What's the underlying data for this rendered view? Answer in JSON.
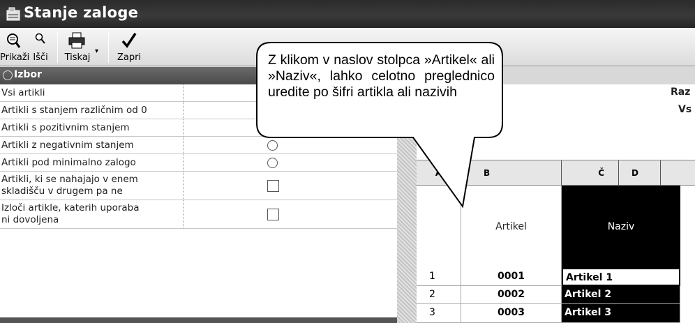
{
  "window": {
    "title": "Stanje zaloge"
  },
  "toolbar": {
    "buttons": [
      {
        "label": "Prikaži",
        "icon": "view-icon"
      },
      {
        "label": "Išči",
        "icon": "search-icon"
      },
      {
        "label": "Tiskaj",
        "icon": "printer-icon"
      },
      {
        "label": "Zapri",
        "icon": "checkmark-icon"
      }
    ]
  },
  "panel": {
    "title": "Izbor",
    "options": [
      {
        "label": "Vsi artikli",
        "control": "radio",
        "selected": false
      },
      {
        "label": "Artikli s stanjem različnim od 0",
        "control": "radio",
        "selected": true
      },
      {
        "label": "Artikli s pozitivnim stanjem",
        "control": "radio",
        "selected": false
      },
      {
        "label": "Artikli z negativnim stanjem",
        "control": "radio",
        "selected": false
      },
      {
        "label": "Artikli pod minimalno zalogo",
        "control": "radio",
        "selected": false
      },
      {
        "label_line1": "Artikli, ki se nahajajo v enem",
        "label_line2": "skladišču v drugem pa ne",
        "control": "checkbox",
        "checked": false
      },
      {
        "label_line1": "Izloči artikle, katerih uporaba",
        "label_line2": "ni dovoljena",
        "control": "checkbox",
        "checked": false
      }
    ]
  },
  "grid": {
    "header_right_1": "Raz",
    "header_right_2": "Vs",
    "column_letters": [
      "A",
      "B",
      "Č",
      "D"
    ],
    "columns": [
      "Artikel",
      "Naziv"
    ],
    "rows": [
      {
        "n": "1",
        "artikel": "0001",
        "naziv": "Artikel 1"
      },
      {
        "n": "2",
        "artikel": "0002",
        "naziv": "Artikel 2"
      },
      {
        "n": "3",
        "artikel": "0003",
        "naziv": "Artikel 3"
      }
    ]
  },
  "callout": {
    "text": "Z klikom v naslov stolpca »Artikel« ali »Naziv«, lahko celotno preglednico uredite po šifri artikla ali nazivih"
  },
  "colors": {
    "titlebar": "#2b2b2b",
    "panel_header": "#555555",
    "selection": "#000000"
  }
}
